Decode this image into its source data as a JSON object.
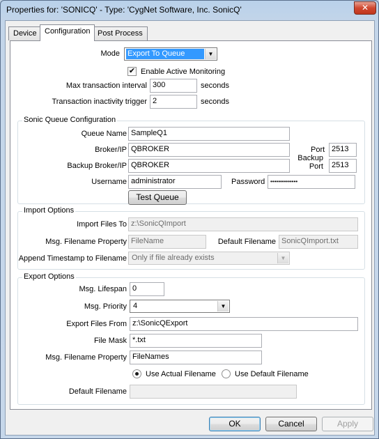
{
  "window": {
    "title": "Properties for: 'SONICQ' - Type: 'CygNet Software, Inc. SonicQ'",
    "close_glyph": "✕"
  },
  "tabs": [
    {
      "label": "Device"
    },
    {
      "label": "Configuration"
    },
    {
      "label": "Post Process"
    }
  ],
  "config": {
    "mode_label": "Mode",
    "mode_value": "Export To Queue",
    "enable_monitoring_label": "Enable Active Monitoring",
    "enable_monitoring_checked": true,
    "max_interval_label": "Max transaction interval",
    "max_interval_value": "300",
    "max_interval_units": "seconds",
    "inactivity_label": "Transaction inactivity trigger",
    "inactivity_value": "2",
    "inactivity_units": "seconds"
  },
  "sonic": {
    "legend": "Sonic Queue Configuration",
    "queue_name_label": "Queue Name",
    "queue_name_value": "SampleQ1",
    "broker_label": "Broker/IP",
    "broker_value": "QBROKER",
    "port_label": "Port",
    "port_value": "2513",
    "backup_broker_label": "Backup Broker/IP",
    "backup_broker_value": "QBROKER",
    "backup_port_label_1": "Backup",
    "backup_port_label_2": "Port",
    "backup_port_value": "2513",
    "username_label": "Username",
    "username_value": "administrator",
    "password_label": "Password",
    "password_value": "••••••••••••••",
    "test_button": "Test Queue"
  },
  "import": {
    "legend": "Import Options",
    "files_to_label": "Import Files To",
    "files_to_value": "z:\\SonicQImport",
    "filename_prop_label": "Msg. Filename Property",
    "filename_prop_value": "FileName",
    "default_filename_label": "Default Filename",
    "default_filename_value": "SonicQImport.txt",
    "append_label": "Append Timestamp to Filename",
    "append_value": "Only if file already exists"
  },
  "export": {
    "legend": "Export Options",
    "lifespan_label": "Msg. Lifespan",
    "lifespan_value": "0",
    "priority_label": "Msg. Priority",
    "priority_value": "4",
    "files_from_label": "Export Files From",
    "files_from_value": "z:\\SonicQExport",
    "file_mask_label": "File Mask",
    "file_mask_value": "*.txt",
    "filename_prop_label": "Msg. Filename Property",
    "filename_prop_value": "FileNames",
    "use_actual_label": "Use Actual Filename",
    "use_default_label": "Use Default Filename",
    "selected_option": "Use Actual Filename",
    "default_filename_label": "Default Filename",
    "default_filename_value": ""
  },
  "buttons": {
    "ok": "OK",
    "cancel": "Cancel",
    "apply": "Apply"
  },
  "glyphs": {
    "dropdown": "▼",
    "check": "✔"
  }
}
